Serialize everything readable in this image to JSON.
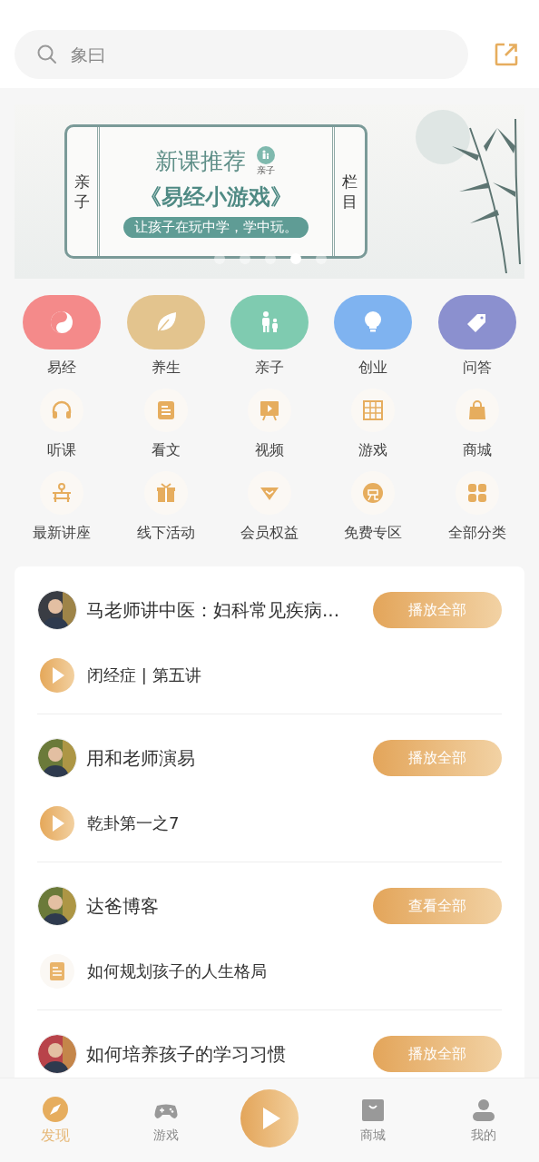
{
  "search": {
    "placeholder": "象曰"
  },
  "banner": {
    "side_left": "亲子",
    "side_right": "栏目",
    "title": "新课推荐",
    "badge": "亲子",
    "headline": "《易经小游戏》",
    "slogan": "让孩子在玩中学，学中玩。",
    "dots": [
      {
        "selected": false
      },
      {
        "selected": false
      },
      {
        "selected": false
      },
      {
        "selected": true
      },
      {
        "selected": false
      }
    ]
  },
  "categories": [
    {
      "label": "易经",
      "color": "#f48a8a"
    },
    {
      "label": "养生",
      "color": "#e3c48e"
    },
    {
      "label": "亲子",
      "color": "#7fcbb0"
    },
    {
      "label": "创业",
      "color": "#7fb3f0"
    },
    {
      "label": "问答",
      "color": "#8b90cf"
    }
  ],
  "shortcuts": [
    {
      "label": "听课"
    },
    {
      "label": "看文"
    },
    {
      "label": "视频"
    },
    {
      "label": "游戏"
    },
    {
      "label": "商城"
    },
    {
      "label": "最新讲座"
    },
    {
      "label": "线下活动"
    },
    {
      "label": "会员权益"
    },
    {
      "label": "免费专区"
    },
    {
      "label": "全部分类"
    }
  ],
  "feed": [
    {
      "title": "马老师讲中医：妇科常见疾病...",
      "button": "播放全部",
      "item": {
        "kind": "audio",
        "title": "闭经症 | 第五讲"
      }
    },
    {
      "title": "用和老师演易",
      "button": "播放全部",
      "item": {
        "kind": "audio",
        "title": "乾卦第一之7"
      }
    },
    {
      "title": "达爸博客",
      "button": "查看全部",
      "item": {
        "kind": "article",
        "title": "如何规划孩子的人生格局"
      }
    },
    {
      "title": "如何培养孩子的学习习惯",
      "button": "播放全部"
    }
  ],
  "tabbar": [
    {
      "label": "发现",
      "selected": true
    },
    {
      "label": "游戏",
      "selected": false
    },
    {
      "kind": "play"
    },
    {
      "label": "商城",
      "selected": false
    },
    {
      "label": "我的",
      "selected": false
    }
  ]
}
